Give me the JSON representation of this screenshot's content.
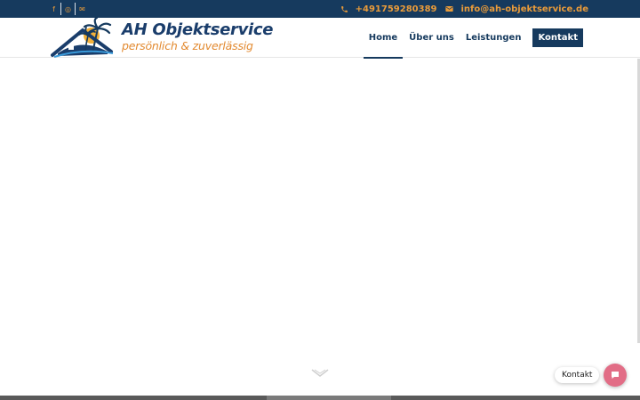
{
  "topbar": {
    "social": [
      {
        "name": "facebook",
        "glyph": "f"
      },
      {
        "name": "instagram",
        "glyph": "◎"
      },
      {
        "name": "mail",
        "glyph": "✉"
      }
    ],
    "phone": "+491759280389",
    "email": "info@ah-objektservice.de"
  },
  "logo": {
    "title": "AH Objektservice",
    "tagline": "persönlich & zuverlässig"
  },
  "nav": {
    "home": "Home",
    "about": "Über uns",
    "services": "Leistungen",
    "contact": "Kontakt"
  },
  "chat": {
    "label": "Kontakt"
  },
  "colors": {
    "navy": "#163a5e",
    "orange": "#e99b3a",
    "chat": "#e26d86"
  }
}
